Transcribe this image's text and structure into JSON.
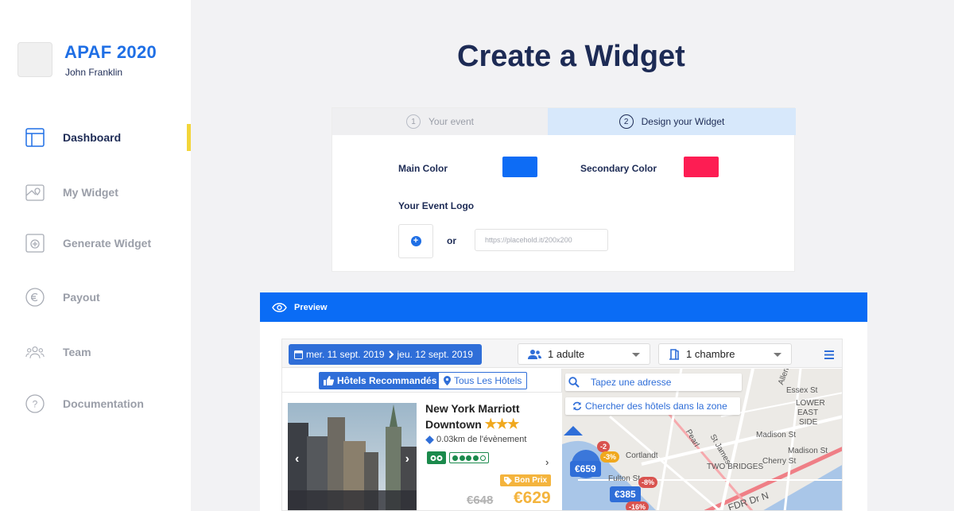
{
  "sidebar": {
    "brand_title": "APAF 2020",
    "user_name": "John Franklin",
    "items": [
      {
        "label": "Dashboard",
        "icon": "layout-icon",
        "active": true
      },
      {
        "label": "My Widget",
        "icon": "map-pin-icon",
        "active": false
      },
      {
        "label": "Generate Widget",
        "icon": "add-widget-icon",
        "active": false
      },
      {
        "label": "Payout",
        "icon": "euro-icon",
        "active": false
      },
      {
        "label": "Team",
        "icon": "team-icon",
        "active": false
      },
      {
        "label": "Documentation",
        "icon": "help-icon",
        "active": false
      }
    ],
    "active_indicator_color": "#f3d53a"
  },
  "main": {
    "title": "Create a Widget",
    "steps": [
      {
        "number": "1",
        "label": "Your event",
        "active": false
      },
      {
        "number": "2",
        "label": "Design your Widget",
        "active": true
      }
    ],
    "form": {
      "main_color_label": "Main Color",
      "main_color": "#0d6cf5",
      "secondary_color_label": "Secondary Color",
      "secondary_color": "#fd1d53",
      "logo_label": "Your Event Logo",
      "or_text": "or",
      "logo_url_placeholder": "https://placehold.it/200x200",
      "logo_url_value": ""
    }
  },
  "preview": {
    "header_label": "Preview",
    "widget": {
      "checkin": "mer. 11 sept. 2019",
      "checkout": "jeu. 12 sept. 2019",
      "guests": "1 adulte",
      "rooms": "1 chambre",
      "tab_recommended": "Hôtels Recommandés",
      "tab_all": "Tous Les Hôtels",
      "hotel": {
        "name": "New York Marriott Downtown",
        "stars": "★★★",
        "distance": "0.03km de l'évènement",
        "rating_dots": 4,
        "badge": "Bon Prix",
        "old_price": "€648",
        "price": "€629"
      },
      "map": {
        "search_placeholder": "Tapez une adresse",
        "refresh_label": "Chercher des hôtels dans la zone",
        "streets": [
          "Allen",
          "Essex St",
          "LOWER",
          "EAST",
          "SIDE",
          "Pearl",
          "Madison St",
          "Madison St",
          "St James",
          "Cortlandt",
          "TWO BRIDGES",
          "Cherry St",
          "Fulton St",
          "FDR Dr N"
        ],
        "pins": [
          "€659",
          "€385"
        ],
        "discounts": [
          "-2",
          "-3%",
          "-8%",
          "-16%"
        ]
      }
    }
  },
  "colors": {
    "accent": "#1f6fe5",
    "navy": "#1d2b55",
    "preview_bar": "#0a6cf5",
    "price": "#f4b43d"
  }
}
